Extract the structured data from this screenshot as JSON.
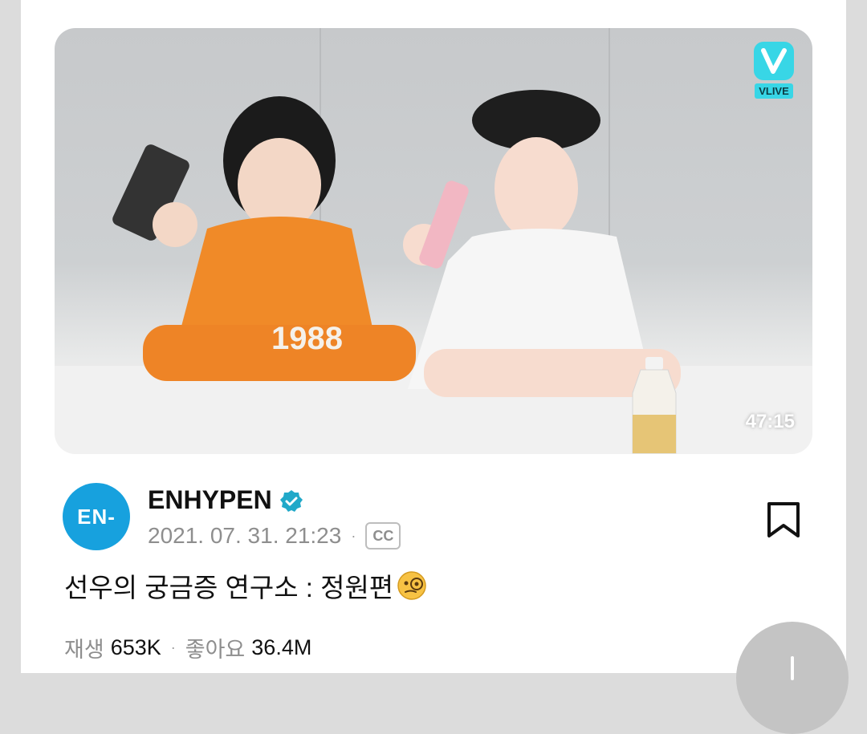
{
  "video": {
    "duration": "47:15",
    "badge_label": "VLIVE",
    "thumbnail_icon": "video-thumbnail-image"
  },
  "channel": {
    "avatar_text": "EN-",
    "name": "ENHYPEN",
    "verified_icon": "verified-badge-icon",
    "date": "2021. 07. 31. 21:23",
    "separator": "·",
    "cc_label": "CC"
  },
  "title": "선우의 궁금증 연구소 : 정원편",
  "stats": {
    "plays_label": "재생",
    "plays_value": "653K",
    "separator": "·",
    "likes_label": "좋아요",
    "likes_value": "36.4M"
  },
  "colors": {
    "accent": "#17a1de",
    "vlive": "#38d6e6",
    "verified": "#21a9c9"
  }
}
